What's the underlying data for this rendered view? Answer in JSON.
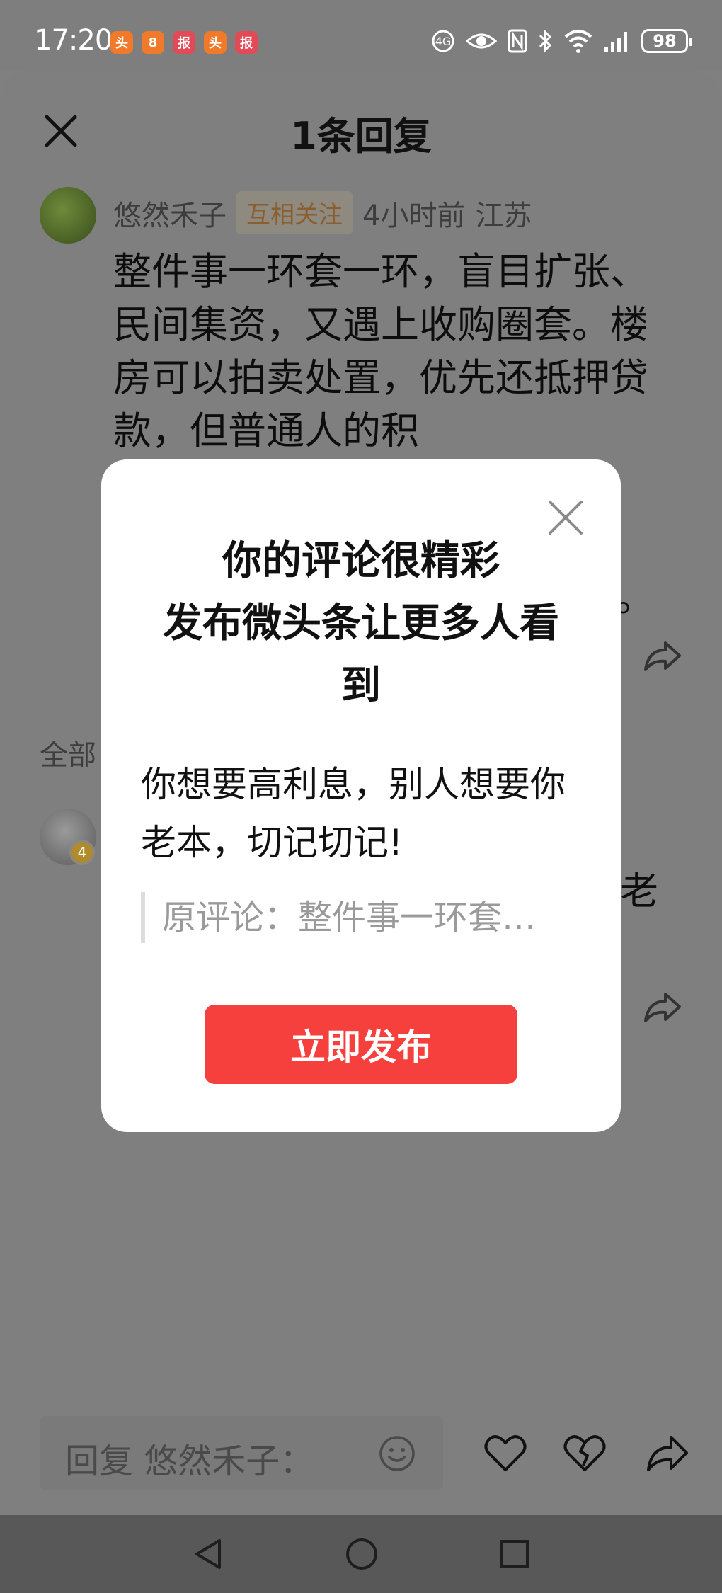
{
  "status_bar": {
    "time": "17:20",
    "battery": "98",
    "notification_apps": [
      {
        "icon": "toutiao-app-icon",
        "color": "#f07a2a",
        "glyph": "头"
      },
      {
        "icon": "xiaohongshu-app-icon",
        "color": "#f07a2a",
        "glyph": "8"
      },
      {
        "icon": "news-app-icon",
        "color": "#e34a58",
        "glyph": "报"
      },
      {
        "icon": "toutiao-app-icon",
        "color": "#f07a2a",
        "glyph": "头"
      },
      {
        "icon": "news-app-icon",
        "color": "#e34a58",
        "glyph": "报"
      }
    ],
    "system_icons": [
      "data-saver-icon",
      "eye-comfort-icon",
      "nfc-icon",
      "bluetooth-icon",
      "wifi-icon",
      "signal-icon"
    ]
  },
  "sheet": {
    "title": "1条回复",
    "comment": {
      "username": "悠然禾子",
      "mutual_badge": "互相关注",
      "time": "4小时前",
      "location": "江苏",
      "text_visible": "整件事一环套一环，盲目扩张、民间集资，又遇上收购圈套。楼房可以拍卖处置，优先还抵押贷款，但普通人的积",
      "text_tail": "。"
    },
    "all_label": "全部",
    "reply_tail_text": "老"
  },
  "bottom_bar": {
    "reply_placeholder": "回复 悠然禾子："
  },
  "modal": {
    "title_line1": "你的评论很精彩",
    "title_line2": "发布微头条让更多人看",
    "title_line3": "到",
    "body_line1": "你想要高利息，别人想要你",
    "body_line2": "老本，切记切记!",
    "quote": "原评论：整件事一环套…",
    "publish_button": "立即发布",
    "accent_color": "#f5403d"
  }
}
